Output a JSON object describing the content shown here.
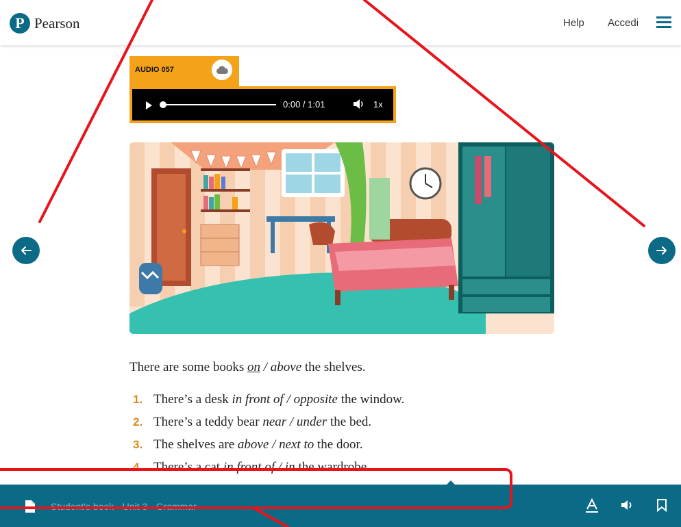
{
  "header": {
    "logo_letter": "P",
    "logo_text": "Pearson",
    "help_label": "Help",
    "login_label": "Accedi",
    "menu_icon": "hamburger-icon"
  },
  "audio": {
    "label": "AUDIO 057",
    "time": "0:00 / 1:01",
    "speed": "1x",
    "progress_fraction": 0,
    "cloud_icon": "cloud-download-icon",
    "play_icon": "play-icon",
    "volume_icon": "volume-icon"
  },
  "exercise": {
    "example": {
      "before": "There are some books ",
      "answer": "on",
      "mid": " / ",
      "option": "above",
      "after": " the shelves."
    },
    "items": [
      {
        "num": "1.",
        "before": "There’s a desk ",
        "options": "in front of / opposite",
        "after": " the window."
      },
      {
        "num": "2.",
        "before": "There’s a teddy bear ",
        "options": "near / under",
        "after": " the bed."
      },
      {
        "num": "3.",
        "before": "The shelves are ",
        "options": "above / next to",
        "after": " the door."
      },
      {
        "num": "4.",
        "before": "There’s a cat ",
        "options": "in front of / in",
        "after": " the wardrobe."
      }
    ]
  },
  "footer": {
    "breadcrumb": "Student's book - Unit 3 - Grammar",
    "doc_icon": "document-icon",
    "text_icon": "text-format-icon",
    "audio_icon": "volume-icon",
    "bookmark_icon": "bookmark-icon"
  },
  "colors": {
    "brand": "#0b6b86",
    "audio_accent": "#f4a21a",
    "number_accent": "#d98a1a",
    "annotation": "#e8141b"
  }
}
